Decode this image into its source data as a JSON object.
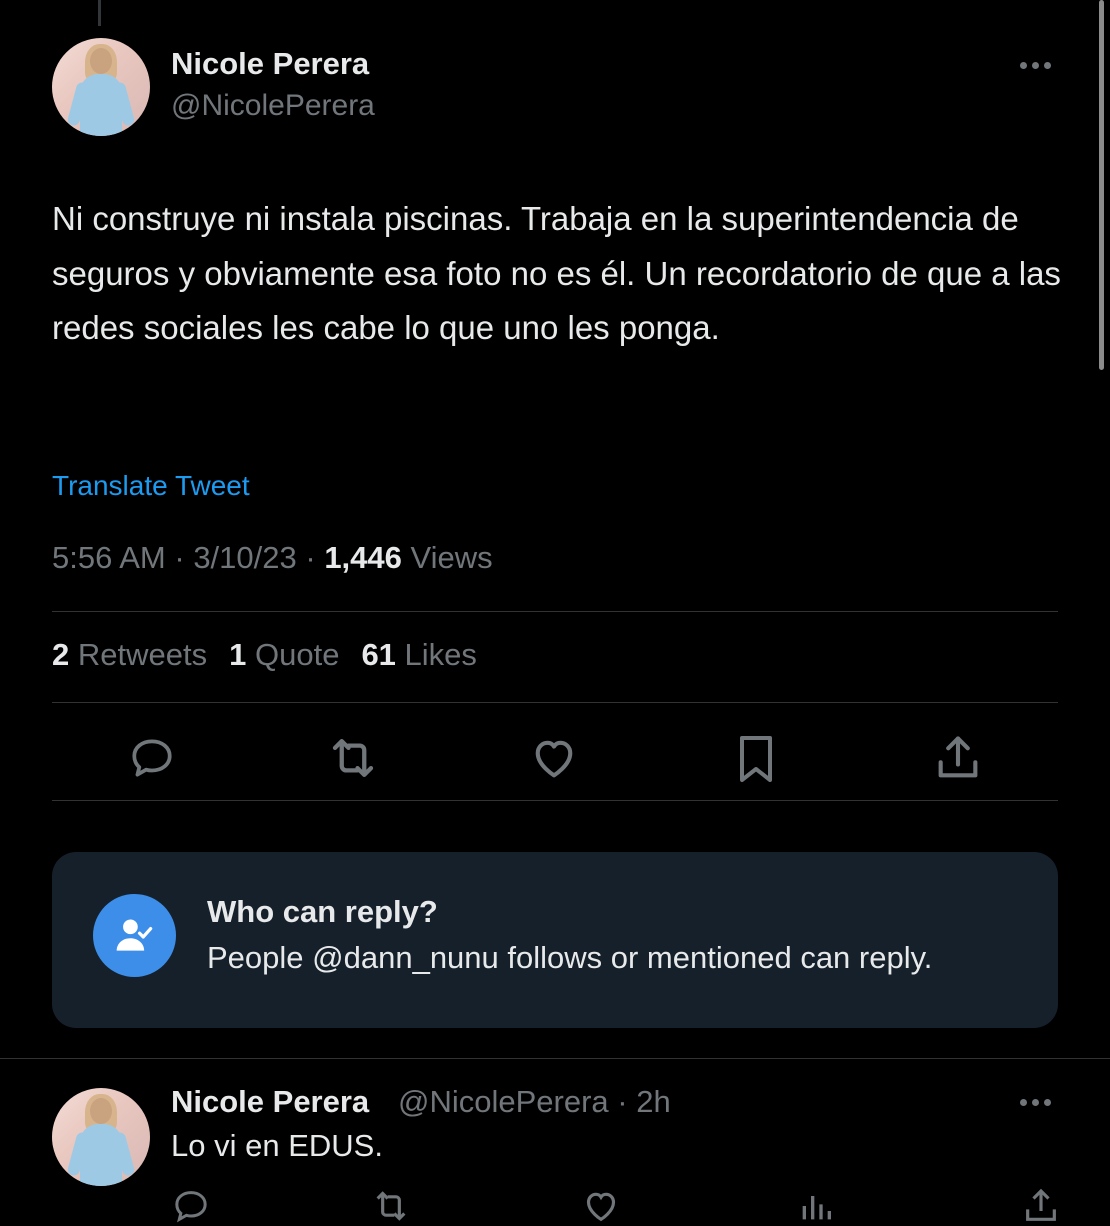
{
  "colors": {
    "background": "#000000",
    "text": "#e7e9ea",
    "muted": "#71767b",
    "link": "#1d9bf0",
    "divider": "#2f3336",
    "reply_box": "#16202b",
    "reply_icon_bg": "#3d8ee8"
  },
  "tweet": {
    "author_name": "Nicole Perera",
    "author_handle": "@NicolePerera",
    "text": "Ni construye ni instala piscinas. Trabaja en la superintendencia de seguros y obviamente esa foto no es él. Un recordatorio de que a las redes sociales les cabe lo que uno les ponga.",
    "translate_label": "Translate Tweet",
    "time": "5:56 AM",
    "date": "3/10/23",
    "views_count": "1,446",
    "views_label": "Views",
    "retweets_count": "2",
    "retweets_label": "Retweets",
    "quotes_count": "1",
    "quotes_label": "Quote",
    "likes_count": "61",
    "likes_label": "Likes",
    "action_icons": [
      "reply-icon",
      "retweet-icon",
      "like-icon",
      "bookmark-icon",
      "share-icon"
    ]
  },
  "reply_restriction": {
    "title": "Who can reply?",
    "description": "People @dann_nunu follows or mentioned can reply.",
    "icon": "user-check-icon"
  },
  "reply": {
    "author_name": "Nicole Perera",
    "author_handle": "@NicolePerera",
    "time": "2h",
    "text": "Lo vi en EDUS."
  }
}
